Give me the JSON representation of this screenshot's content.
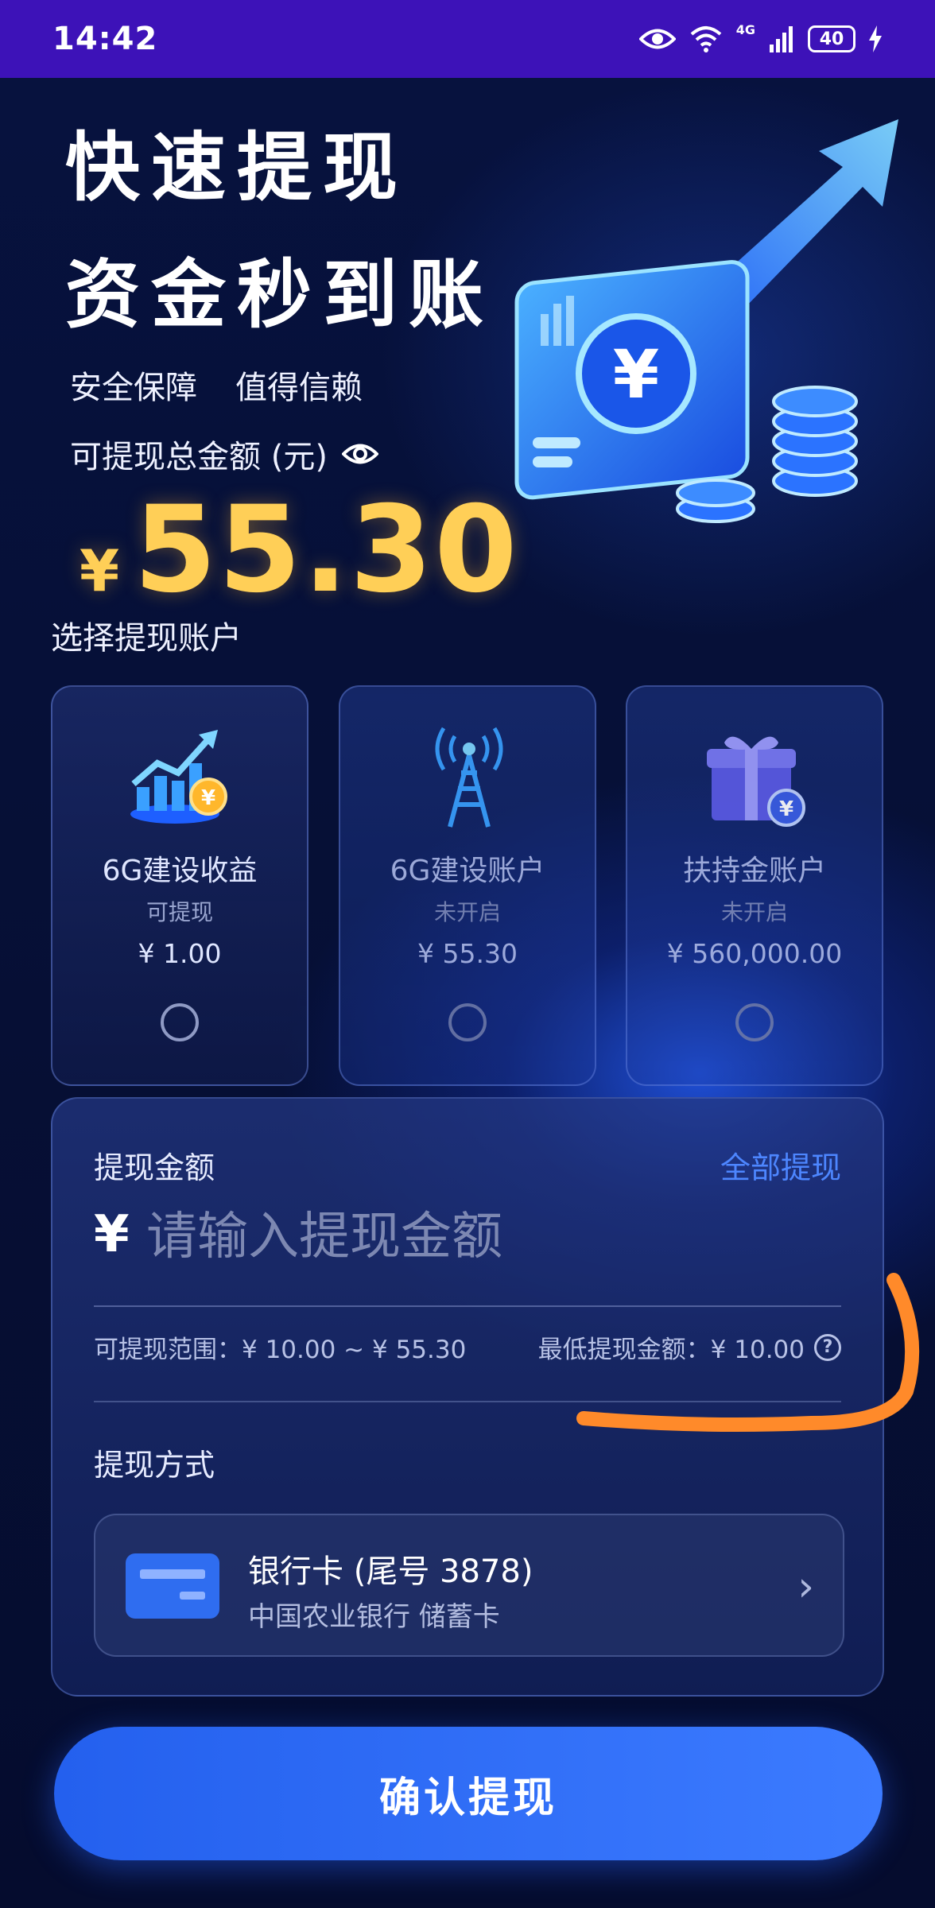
{
  "status_bar": {
    "time": "14:42",
    "network": "4G",
    "battery": "40"
  },
  "hero": {
    "title_line1": "快速提现",
    "title_line2": "资金秒到账",
    "tag1": "安全保障",
    "tag2": "值得信赖",
    "total_label": "可提现总金额 (元)",
    "currency_symbol": "¥",
    "total_amount": "55.30"
  },
  "accounts": {
    "section_title": "选择提现账户",
    "items": [
      {
        "name": "6G建设收益",
        "status": "可提现",
        "balance": "¥ 1.00",
        "icon": "growth-chart-coin-icon",
        "enabled": true
      },
      {
        "name": "6G建设账户",
        "status": "未开启",
        "balance": "¥ 55.30",
        "icon": "signal-tower-icon",
        "enabled": false
      },
      {
        "name": "扶持金账户",
        "status": "未开启",
        "balance": "¥ 560,000.00",
        "icon": "gift-box-coin-icon",
        "enabled": false
      }
    ]
  },
  "withdraw": {
    "amount_label": "提现金额",
    "withdraw_all": "全部提现",
    "currency_symbol": "¥",
    "amount_placeholder": "请输入提现金额",
    "range_text": "可提现范围：¥ 10.00 ~ ¥ 55.30",
    "min_text": "最低提现金额：¥ 10.00",
    "method_label": "提现方式",
    "bank": {
      "title": "银行卡 (尾号 3878)",
      "subtitle": "中国农业银行 储蓄卡",
      "icon": "bank-card-icon"
    }
  },
  "confirm_button": "确认提现",
  "colors": {
    "status_bar": "#3d12b8",
    "accent_gold": "#ffcf57",
    "link_blue": "#4d86ff",
    "button_blue": "#2f6df0",
    "annotation_orange": "#ff8a2a"
  }
}
